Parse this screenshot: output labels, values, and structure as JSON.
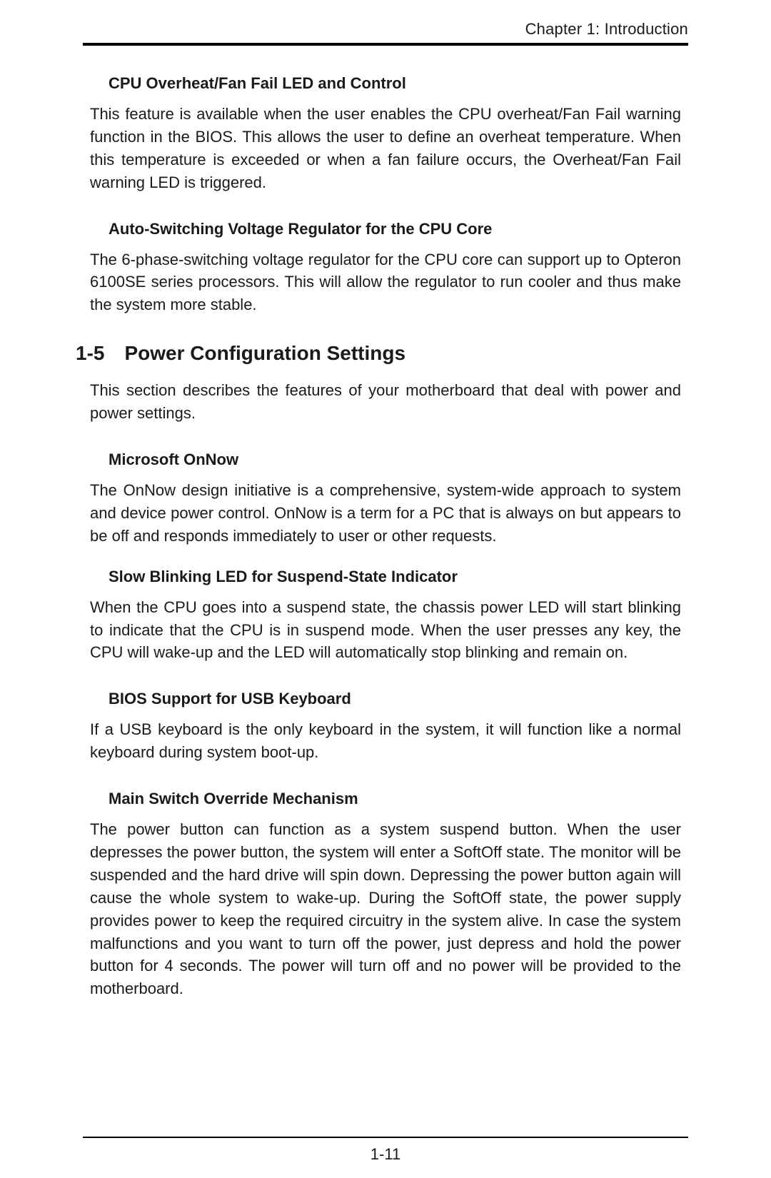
{
  "header": {
    "chapter_label": "Chapter 1: Introduction"
  },
  "sections": {
    "s1": {
      "heading": "CPU Overheat/Fan Fail LED and Control",
      "body": "This feature is available when the user enables the CPU overheat/Fan Fail warning function in the BIOS. This allows the user to define an overheat temperature. When this temperature is exceeded or when a fan failure occurs, the Overheat/Fan Fail warning LED is triggered."
    },
    "s2": {
      "heading": "Auto-Switching Voltage Regulator for the CPU Core",
      "body": "The 6-phase-switching voltage regulator for the CPU core can support up to Opteron 6100SE series processors. This will allow the regulator to run cooler and thus make the system more stable."
    },
    "main": {
      "number": "1-5",
      "title": "Power Configuration Settings",
      "intro": "This section describes the features of your motherboard that deal with power and power settings."
    },
    "s3": {
      "heading": "Microsoft OnNow",
      "body": "The OnNow design initiative is a comprehensive, system-wide approach to system and device power control. OnNow is a term for a PC that is always on but appears to be off and responds immediately to user or other requests."
    },
    "s4": {
      "heading": "Slow Blinking LED for Suspend-State Indicator",
      "body": "When the CPU goes into a suspend state, the chassis power LED will start blinking to indicate that the CPU is in suspend mode. When the user presses any key, the CPU will wake-up and the LED will automatically stop blinking and remain on."
    },
    "s5": {
      "heading": "BIOS Support for USB Keyboard",
      "body": "If a USB keyboard is the only keyboard in the system, it will function like a normal keyboard during system boot-up."
    },
    "s6": {
      "heading": "Main Switch Override Mechanism",
      "body": "The power button can function as a system suspend button. When the user depresses the power button, the system will enter a SoftOff state. The monitor will be suspended and the hard drive will spin down. Depressing the power button again will cause the whole system to wake-up. During the SoftOff state, the power supply provides power to keep the required circuitry in the system alive. In case the system malfunctions and you want to turn off the power, just depress and hold the power button for 4 seconds. The power will turn off and no power will be provided to the motherboard."
    }
  },
  "footer": {
    "page_number": "1-11"
  }
}
